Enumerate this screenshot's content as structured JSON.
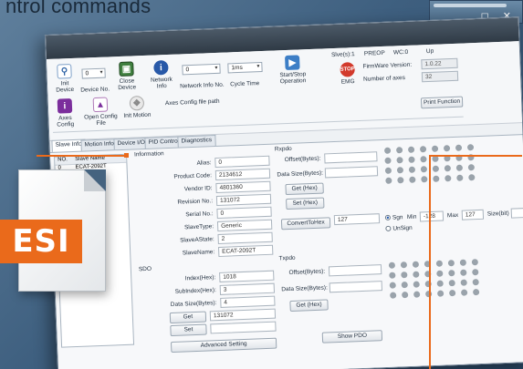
{
  "headline": "ntrol commands",
  "window_controls": "_ ◻ ✕",
  "toolbar": {
    "init_device": "Init Device",
    "device_no_label": "Device No.",
    "device_no_value": "0",
    "close_device": "Close Device",
    "network_info": "Network Info",
    "network_info_no": "Network Info No.",
    "network_info_no_value": "0",
    "cycle_time_label": "Cycle Time",
    "cycle_time_value": "1ms",
    "start_stop": "Start/Stop Operation",
    "axes_config": "Axes Config",
    "open_config_file": "Open Config File",
    "init_motion": "Init Motion",
    "axes_config_path": "Axes Config file path",
    "slave_count": "Slve(s):1",
    "state": "PREOP",
    "wc": "WC:0",
    "up": "Up",
    "firmware_label": "FirmWare Version:",
    "firmware_value": "1.0.22",
    "axes_label": "Number of axes",
    "axes_value": "32",
    "emg": "EMG",
    "print_function": "Print Function"
  },
  "tabs": [
    "Slave Info",
    "Motion Info",
    "Device I/O",
    "PID Control",
    "Diagnostics"
  ],
  "slave_list": {
    "headers": [
      "NO.",
      "Slave Name"
    ],
    "rows": [
      [
        "0",
        "ECAT-2092T"
      ]
    ]
  },
  "information": {
    "title": "Information",
    "fields": [
      {
        "label": "Alias:",
        "value": "0"
      },
      {
        "label": "Product Code:",
        "value": "2134612"
      },
      {
        "label": "Vendor ID:",
        "value": "4801360"
      },
      {
        "label": "Revision No.:",
        "value": "131072"
      },
      {
        "label": "Serial No.:",
        "value": "0"
      },
      {
        "label": "SlaveType:",
        "value": "Generic"
      },
      {
        "label": "SlaveAState:",
        "value": "2"
      },
      {
        "label": "SlaveName:",
        "value": "ECAT-2092T"
      }
    ]
  },
  "sdo": {
    "title": "SDO",
    "index_label": "Index(Hex):",
    "index_value": "1018",
    "subindex_label": "SubIndex(Hex):",
    "subindex_value": "3",
    "size_label": "Data Size(Bytes):",
    "size_value": "4",
    "get_label": "Get",
    "get_value": "131072",
    "set_label": "Set",
    "advanced": "Advanced Setting"
  },
  "rxpdo": {
    "title": "Rxpdo",
    "offset_label": "Offset(Bytes):",
    "size_label": "Data Size(Bytes):",
    "get_hex": "Get (Hex)",
    "set_hex": "Set (Hex)",
    "convert": "ConvertToHex",
    "convert_value": "127",
    "sign": "Sgn",
    "unsign": "UnSign",
    "min_label": "Min",
    "min_value": "-128",
    "max_label": "Max",
    "max_value": "127",
    "size_bit_label": "Size(bit)"
  },
  "txpdo": {
    "title": "Txpdo",
    "offset_label": "Offset(Bytes):",
    "size_label": "Data Size(Bytes):",
    "get_hex": "Get (Hex)",
    "show_pdo": "Show PDO"
  },
  "esi_badge": "ESI",
  "colors": {
    "accent": "#ea6a1b",
    "titlebar": "#3a4652",
    "dot": "#9aa3ab"
  }
}
